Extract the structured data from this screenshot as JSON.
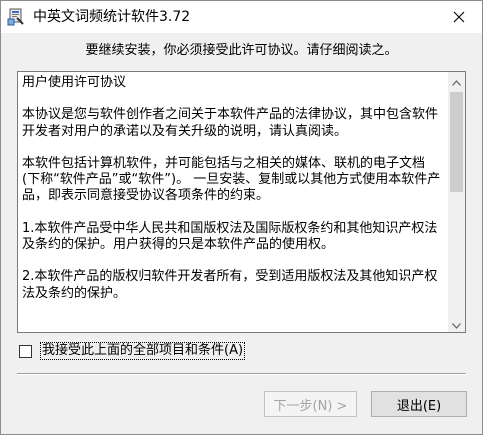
{
  "window": {
    "title": "中英文词频统计软件3.72",
    "app_icon": "installer-icon",
    "close_icon": "close-icon"
  },
  "prompt": "要继续安装，你必须接受此许可协议。请仔细阅读之。",
  "license": {
    "text": "用户使用许可协议\n\n本协议是您与软件创作者之间关于本软件产品的法律协议，其中包含软件开发者对用户的承诺以及有关升级的说明，请认真阅读。\n\n本软件包括计算机软件，并可能包括与之相关的媒体、联机的电子文档(下称“软件产品”或“软件”)。 一旦安装、复制或以其他方式使用本软件产品，即表示同意接受协议各项条件的约束。\n\n1.本软件产品受中华人民共和国版权法及国际版权条约和其他知识产权法及条约的保护。用户获得的只是本软件产品的使用权。\n\n2.本软件产品的版权归软件开发者所有，受到适用版权法及其他知识产权法及条约的保护。",
    "scroll_up_icon": "chevron-up-icon",
    "scroll_down_icon": "chevron-down-icon"
  },
  "agree": {
    "label": "我接受此上面的全部项目和条件(A)",
    "checked": false
  },
  "buttons": {
    "next_label": "下一步(N) >",
    "exit_label": "退出(E)"
  }
}
